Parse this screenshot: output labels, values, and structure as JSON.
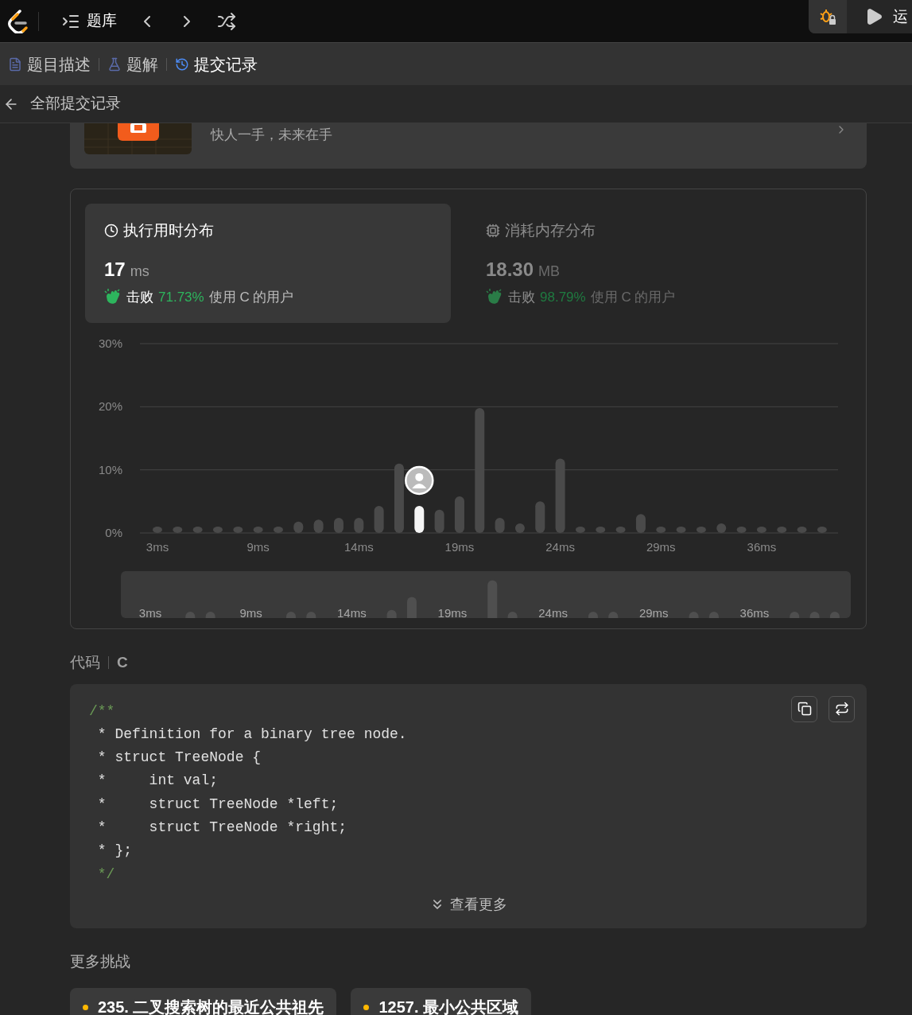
{
  "top_bar": {
    "nav_label": "题库",
    "run_label": "运"
  },
  "tabs": [
    {
      "label": "题目描述",
      "selected": false
    },
    {
      "label": "题解",
      "selected": false
    },
    {
      "label": "提交记录",
      "selected": true
    }
  ],
  "back_link": "全部提交记录",
  "banner": {
    "text": "快人一手，未来在手"
  },
  "stats": [
    {
      "title": "执行用时分布",
      "value": "17",
      "unit": "ms",
      "beat": "击败",
      "percent": "71.73%",
      "suffix": "使用 C 的用户",
      "selected": true
    },
    {
      "title": "消耗内存分布",
      "value": "18.30",
      "unit": "MB",
      "beat": "击败",
      "percent": "98.79%",
      "suffix": "使用 C 的用户",
      "selected": false
    }
  ],
  "chart": {
    "chart_data": {
      "type": "bar",
      "ylim": [
        0,
        30
      ],
      "yticks": [
        {
          "value": 0,
          "label": "0%"
        },
        {
          "value": 10,
          "label": "10%"
        },
        {
          "value": 20,
          "label": "20%"
        },
        {
          "value": 30,
          "label": "30%"
        }
      ],
      "categories": [
        "3ms",
        null,
        null,
        null,
        null,
        "9ms",
        null,
        null,
        null,
        null,
        "14ms",
        null,
        null,
        null,
        null,
        "19ms",
        null,
        null,
        null,
        null,
        "24ms",
        null,
        null,
        null,
        null,
        "29ms",
        null,
        null,
        null,
        null,
        "36ms",
        null,
        null,
        null
      ],
      "values": [
        1,
        1,
        1,
        1,
        1,
        1,
        1,
        1.8,
        2.1,
        2.4,
        2.4,
        4.3,
        11,
        4.3,
        3.7,
        5.8,
        19.8,
        2.4,
        1.5,
        5.0,
        11.8,
        1,
        1,
        1,
        3.0,
        1,
        1,
        1,
        1.5,
        1,
        1,
        1,
        1,
        1
      ]
    },
    "bars": [
      {
        "selected": false
      },
      {
        "selected": false
      },
      {
        "selected": false
      },
      {
        "selected": false
      },
      {
        "selected": false
      },
      {
        "selected": false
      },
      {
        "selected": false
      },
      {
        "selected": false
      },
      {
        "selected": false
      },
      {
        "selected": false
      },
      {
        "selected": false
      },
      {
        "selected": false
      },
      {
        "selected": false
      },
      {
        "selected": true
      },
      {
        "selected": false
      },
      {
        "selected": false
      },
      {
        "selected": false
      },
      {
        "selected": false
      },
      {
        "selected": false
      },
      {
        "selected": false
      },
      {
        "selected": false
      },
      {
        "selected": false
      },
      {
        "selected": false
      },
      {
        "selected": false
      },
      {
        "selected": false
      },
      {
        "selected": false
      },
      {
        "selected": false
      },
      {
        "selected": false
      },
      {
        "selected": false
      },
      {
        "selected": false
      },
      {
        "selected": false
      },
      {
        "selected": false
      },
      {
        "selected": false
      },
      {
        "selected": false
      }
    ],
    "overview_labels": [
      "3ms",
      "9ms",
      "14ms",
      "19ms",
      "24ms",
      "29ms",
      "36ms"
    ]
  },
  "code_section": {
    "title": "代码",
    "language": "C",
    "lines": [
      {
        "kind": "comment",
        "text": "/**"
      },
      {
        "kind": "text",
        "text": " * Definition for a binary tree node."
      },
      {
        "kind": "text",
        "text": " * struct TreeNode {"
      },
      {
        "kind": "text",
        "text": " *     int val;"
      },
      {
        "kind": "text",
        "text": " *     struct TreeNode *left;"
      },
      {
        "kind": "text",
        "text": " *     struct TreeNode *right;"
      },
      {
        "kind": "text",
        "text": " * };"
      },
      {
        "kind": "comment",
        "text": " */"
      }
    ],
    "more": "查看更多"
  },
  "more_challenges": {
    "title": "更多挑战",
    "items": [
      {
        "label": "235. 二叉搜索树的最近公共祖先",
        "color": "#ffb800"
      },
      {
        "label": "1257. 最小公共区域",
        "color": "#ffb800"
      }
    ]
  }
}
